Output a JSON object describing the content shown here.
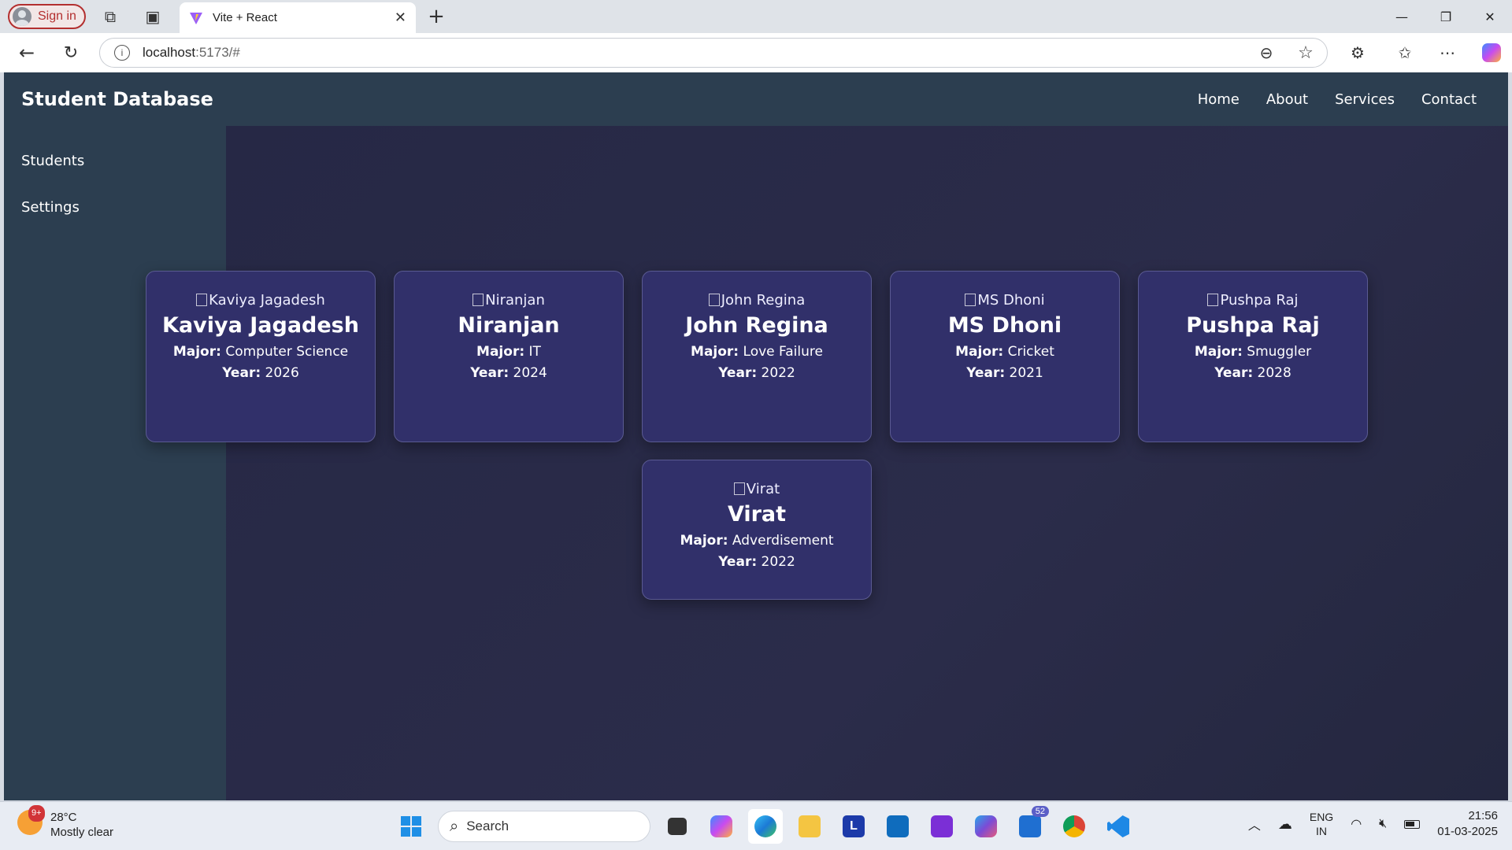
{
  "browser": {
    "signin_label": "Sign in",
    "tab_title": "Vite + React",
    "url_host": "localhost",
    "url_rest": ":5173/#"
  },
  "app": {
    "brand": "Student Database",
    "nav": [
      "Home",
      "About",
      "Services",
      "Contact"
    ],
    "sidebar": [
      "Students",
      "Settings"
    ],
    "major_label": "Major:",
    "year_label": "Year:",
    "students": [
      {
        "alt": "Kaviya Jagadesh",
        "name": "Kaviya Jagadesh",
        "major": "Computer Science",
        "year": "2026"
      },
      {
        "alt": "Niranjan",
        "name": "Niranjan",
        "major": "IT",
        "year": "2024"
      },
      {
        "alt": "John Regina",
        "name": "John Regina",
        "major": "Love Failure",
        "year": "2022"
      },
      {
        "alt": "MS Dhoni",
        "name": "MS Dhoni",
        "major": "Cricket",
        "year": "2021"
      },
      {
        "alt": "Pushpa Raj",
        "name": "Pushpa Raj",
        "major": "Smuggler",
        "year": "2028"
      },
      {
        "alt": "Virat",
        "name": "Virat",
        "major": "Adverdisement",
        "year": "2022"
      }
    ]
  },
  "taskbar": {
    "weather_temp": "28°C",
    "weather_desc": "Mostly clear",
    "weather_badge": "9+",
    "search_label": "Search",
    "teams_count": "52",
    "lang_top": "ENG",
    "lang_bottom": "IN",
    "time": "21:56",
    "date": "01-03-2025"
  },
  "colors": {
    "nav_bg": "#2c3e50",
    "main_bg": "#262845",
    "card_bg": "#31306a",
    "accent_red": "#b32f2f"
  }
}
